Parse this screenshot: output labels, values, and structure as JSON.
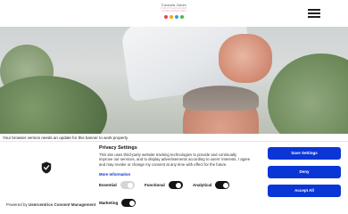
{
  "header": {
    "logo": {
      "name": "Carmen Jones",
      "sub_line1": "PHOTOGRAPHER",
      "sub_line2": "VIDEOGRAPHER",
      "dot_colors": [
        "#e8443b",
        "#f2a81d",
        "#3a9ad9",
        "#4cb548"
      ]
    },
    "menu_icon": "hamburger-icon"
  },
  "hero": {
    "description_colors": {
      "foliage": "#6d8a5a",
      "shirt": "#e4e7ea",
      "skin": "#c98a73"
    }
  },
  "browser_warning": "Your browser version needs an update for this banner to work properly.",
  "consent": {
    "logo_icon": "usercentrics-shield-icon",
    "powered_prefix": "Powered by ",
    "powered_brand": "Usercentrics Consent Management",
    "title": "Privacy Settings",
    "body": "This site uses third-party website tracking technologies to provide and continually improve our services, and to display advertisements according to users' interests. I agree and may revoke or change my consent at any time with effect for the future.",
    "more_info": "More Information",
    "toggles": {
      "essential": {
        "label": "Essential",
        "state": "disabled-on"
      },
      "functional": {
        "label": "Functional",
        "state": "on"
      },
      "analytical": {
        "label": "Analytical",
        "state": "on"
      },
      "marketing": {
        "label": "Marketing",
        "state": "on"
      }
    },
    "buttons": {
      "save": "Save Settings",
      "deny": "Deny",
      "accept": "Accept All"
    },
    "accent_color": "#0b36d6"
  }
}
